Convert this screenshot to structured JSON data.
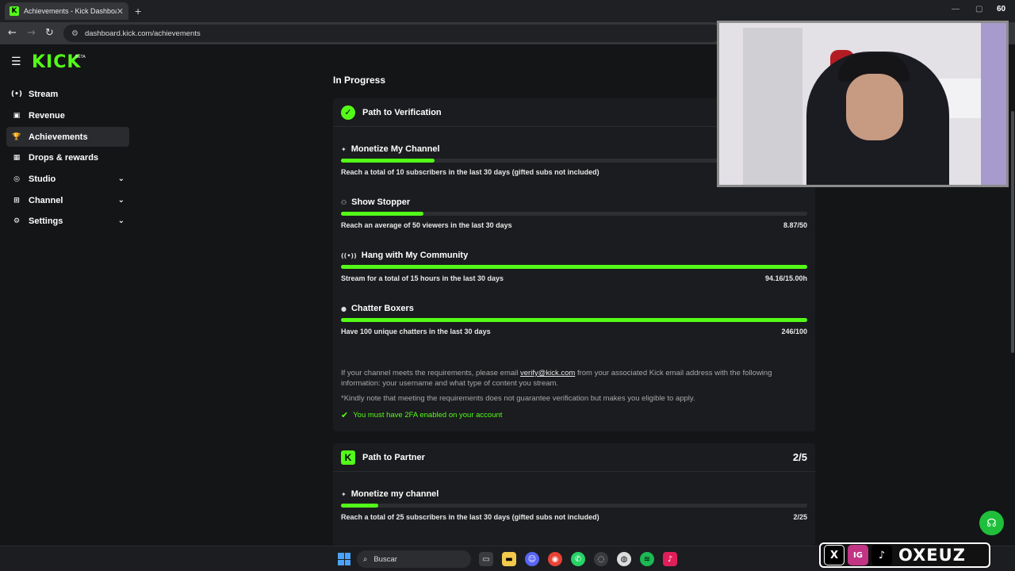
{
  "browser": {
    "tab_title": "Achievements - Kick Dashboard",
    "tab_favicon": "K",
    "url": "dashboard.kick.com/achievements",
    "corner_value": "60"
  },
  "sidebar": {
    "logo": "KICK",
    "logo_badge": "BETA",
    "items": [
      {
        "label": "Stream",
        "icon": "(•)"
      },
      {
        "label": "Revenue",
        "icon": "▣"
      },
      {
        "label": "Achievements",
        "icon": "🏆"
      },
      {
        "label": "Drops & rewards",
        "icon": "▦"
      },
      {
        "label": "Studio",
        "icon": "◎"
      },
      {
        "label": "Channel",
        "icon": "⊞"
      },
      {
        "label": "Settings",
        "icon": "⚙"
      }
    ]
  },
  "main": {
    "section_title": "In Progress",
    "verification": {
      "title": "Path to Verification",
      "tasks": [
        {
          "title": "Monetize My Channel",
          "icon": "✦",
          "desc": "Reach a total of 10 subscribers in the last 30 days (gifted subs not included)",
          "value": "",
          "progress": 0.2
        },
        {
          "title": "Show Stopper",
          "icon": "⚇",
          "desc": "Reach an average of 50 viewers in the last 30 days",
          "value": "8.87/50",
          "progress": 0.1774
        },
        {
          "title": "Hang with My Community",
          "icon": "((•))",
          "desc": "Stream for a total of 15 hours in the last 30 days",
          "value": "94.16/15.00h",
          "progress": 1.0
        },
        {
          "title": "Chatter Boxers",
          "icon": "●",
          "desc": "Have 100 unique chatters in the last 30 days",
          "value": "246/100",
          "progress": 1.0
        }
      ],
      "info_prefix": "If your channel meets the requirements, please email ",
      "info_email": "verify@kick.com",
      "info_suffix": " from your associated Kick email address with the following information: your username and what type of content you stream.",
      "note": "*Kindly note that meeting the requirements does not guarantee verification but makes you eligible to apply.",
      "requirement": "You must have 2FA enabled on your account"
    },
    "partner": {
      "title": "Path to Partner",
      "count": "2/5",
      "tasks": [
        {
          "title": "Monetize my channel",
          "icon": "✦",
          "desc": "Reach a total of 25 subscribers in the last 30 days (gifted subs not included)",
          "value": "2/25",
          "progress": 0.08
        }
      ]
    }
  },
  "taskbar": {
    "search_placeholder": "Buscar"
  },
  "overlay": {
    "brand": "OXEUZ",
    "social": [
      "X",
      "IG",
      "♪"
    ]
  },
  "colors": {
    "accent": "#53fc18",
    "bg": "#141517",
    "card": "#1b1c1f"
  }
}
